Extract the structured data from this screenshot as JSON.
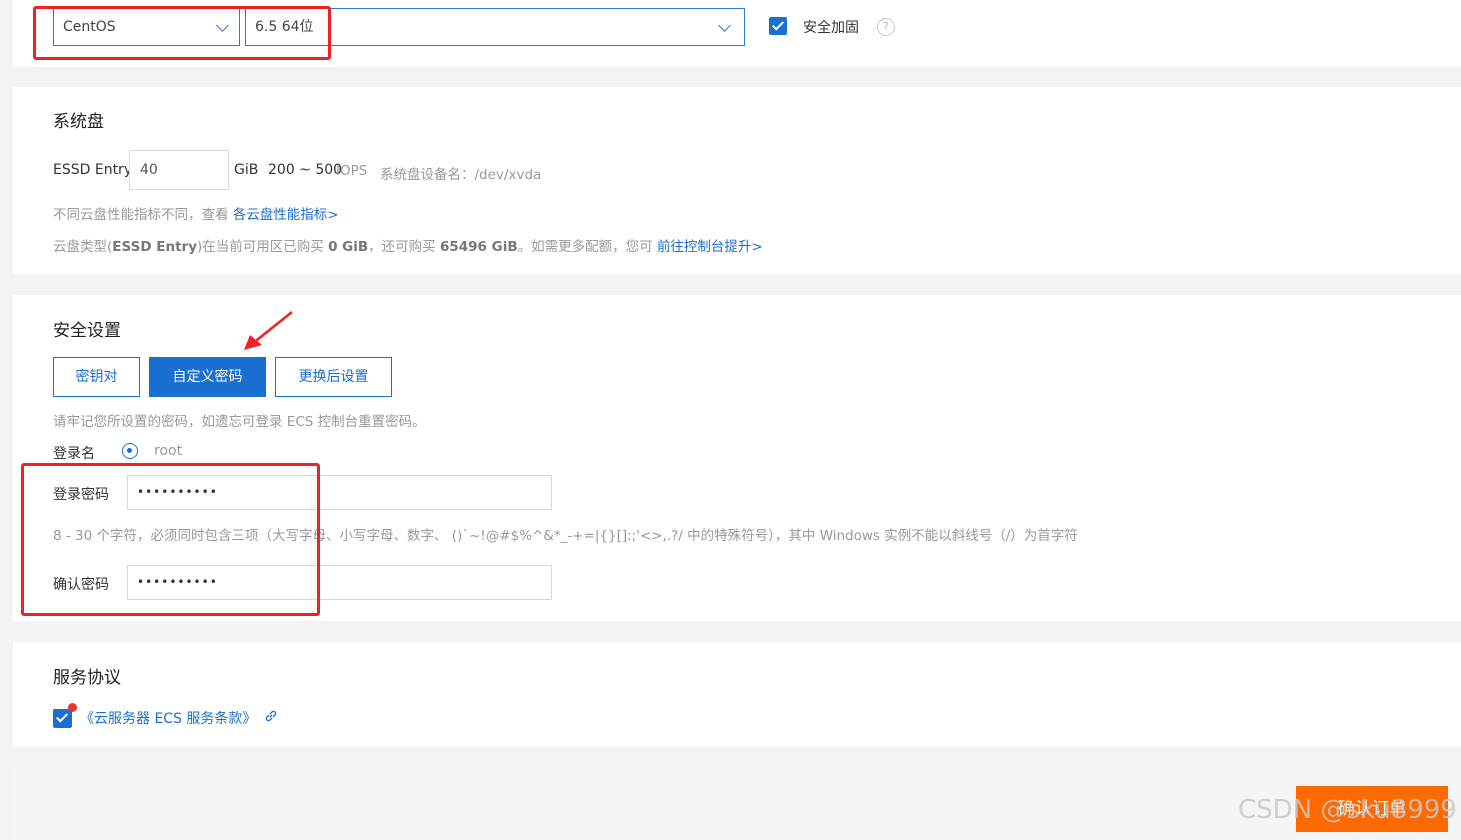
{
  "os": {
    "distro": "CentOS",
    "version": "6.5 64位",
    "security_label": "安全加固"
  },
  "system_disk": {
    "title": "系统盘",
    "type_label": "ESSD Entry",
    "size_value": "40",
    "unit": "GiB",
    "iops_range": "200 ~ 500",
    "iops_label": "IOPS",
    "device_label": "系统盘设备名：/dev/xvda",
    "perf_text": "不同云盘性能指标不同，查看",
    "perf_link": "各云盘性能指标>",
    "quota_text_a": "云盘类型(",
    "quota_type": "ESSD Entry",
    "quota_text_b": ")在当前可用区已购买",
    "quota_bought": "0 GiB",
    "quota_text_c": "，还可购买",
    "quota_left": "65496 GiB",
    "quota_text_d": "。如需更多配额，您可",
    "quota_link": "前往控制台提升>"
  },
  "security": {
    "title": "安全设置",
    "tabs": [
      {
        "label": "密钥对"
      },
      {
        "label": "自定义密码"
      },
      {
        "label": "更换后设置"
      }
    ],
    "hint": "请牢记您所设置的密码，如遗忘可登录 ECS 控制台重置密码。",
    "login_name_label": "登录名",
    "login_name_value": "root",
    "password_label": "登录密码",
    "password_mask": "••••••••••",
    "password_rule": "8 - 30 个字符，必须同时包含三项（大写字母、小写字母、数字、 ()`~!@#$%^&*_-+=|{}[]:;'<>,.?/ 中的特殊符号），其中 Windows 实例不能以斜线号（/）为首字符",
    "confirm_label": "确认密码",
    "confirm_mask": "••••••••••"
  },
  "agreement": {
    "title": "服务协议",
    "link": "《云服务器 ECS 服务条款》"
  },
  "footer": {
    "confirm_button": "确认订单",
    "watermark": "CSDN @sku8999"
  },
  "colors": {
    "accent": "#1b6fd1",
    "annotation": "#ee2222",
    "order_button": "#ff6a00"
  }
}
